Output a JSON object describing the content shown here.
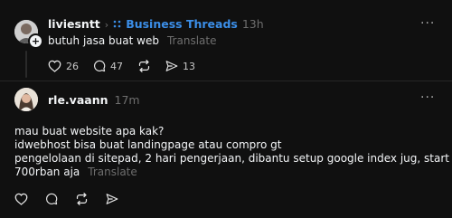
{
  "post1": {
    "username": "liviesntt",
    "topic_separator": "›",
    "topic": "Business Threads",
    "time": "13h",
    "text": "butuh jasa buat web",
    "translate": "Translate",
    "more": "···",
    "actions": {
      "likes": "26",
      "comments": "47",
      "shares": "13"
    }
  },
  "reply1": {
    "username": "rle.vaann",
    "time": "17m",
    "more": "···",
    "lines": [
      "mau buat website apa kak?",
      "idwebhost bisa buat landingpage atau compro gt",
      "pengelolaan di sitepad, 2 hari pengerjaan, dibantu setup google index jug, start",
      "700rban aja"
    ],
    "translate": "Translate"
  },
  "colors": {
    "background": "#101010",
    "topic": "#3b8ee8",
    "muted": "#6e6e6e"
  },
  "icons": [
    "heart-icon",
    "comment-icon",
    "repost-icon",
    "share-icon",
    "more-icon",
    "follow-plus-icon"
  ]
}
